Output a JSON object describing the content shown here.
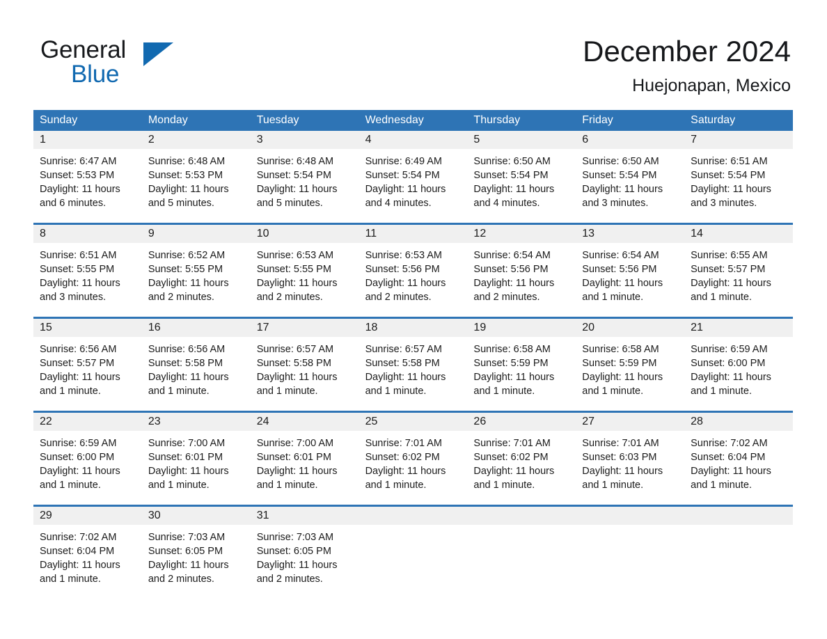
{
  "brand": {
    "name_part1": "General",
    "name_part2": "Blue",
    "triangle_color": "#1169b0"
  },
  "header": {
    "title": "December 2024",
    "subtitle": "Huejonapan, Mexico"
  },
  "colors": {
    "header_blue": "#2e74b5",
    "row_rule_blue": "#2e74b5",
    "daynum_band": "#f0f0f0",
    "text": "#1b1b1b",
    "header_text": "#ffffff"
  },
  "weekdays": [
    "Sunday",
    "Monday",
    "Tuesday",
    "Wednesday",
    "Thursday",
    "Friday",
    "Saturday"
  ],
  "weeks": [
    [
      {
        "day": "1",
        "sunrise": "Sunrise: 6:47 AM",
        "sunset": "Sunset: 5:53 PM",
        "daylight1": "Daylight: 11 hours",
        "daylight2": "and 6 minutes."
      },
      {
        "day": "2",
        "sunrise": "Sunrise: 6:48 AM",
        "sunset": "Sunset: 5:53 PM",
        "daylight1": "Daylight: 11 hours",
        "daylight2": "and 5 minutes."
      },
      {
        "day": "3",
        "sunrise": "Sunrise: 6:48 AM",
        "sunset": "Sunset: 5:54 PM",
        "daylight1": "Daylight: 11 hours",
        "daylight2": "and 5 minutes."
      },
      {
        "day": "4",
        "sunrise": "Sunrise: 6:49 AM",
        "sunset": "Sunset: 5:54 PM",
        "daylight1": "Daylight: 11 hours",
        "daylight2": "and 4 minutes."
      },
      {
        "day": "5",
        "sunrise": "Sunrise: 6:50 AM",
        "sunset": "Sunset: 5:54 PM",
        "daylight1": "Daylight: 11 hours",
        "daylight2": "and 4 minutes."
      },
      {
        "day": "6",
        "sunrise": "Sunrise: 6:50 AM",
        "sunset": "Sunset: 5:54 PM",
        "daylight1": "Daylight: 11 hours",
        "daylight2": "and 3 minutes."
      },
      {
        "day": "7",
        "sunrise": "Sunrise: 6:51 AM",
        "sunset": "Sunset: 5:54 PM",
        "daylight1": "Daylight: 11 hours",
        "daylight2": "and 3 minutes."
      }
    ],
    [
      {
        "day": "8",
        "sunrise": "Sunrise: 6:51 AM",
        "sunset": "Sunset: 5:55 PM",
        "daylight1": "Daylight: 11 hours",
        "daylight2": "and 3 minutes."
      },
      {
        "day": "9",
        "sunrise": "Sunrise: 6:52 AM",
        "sunset": "Sunset: 5:55 PM",
        "daylight1": "Daylight: 11 hours",
        "daylight2": "and 2 minutes."
      },
      {
        "day": "10",
        "sunrise": "Sunrise: 6:53 AM",
        "sunset": "Sunset: 5:55 PM",
        "daylight1": "Daylight: 11 hours",
        "daylight2": "and 2 minutes."
      },
      {
        "day": "11",
        "sunrise": "Sunrise: 6:53 AM",
        "sunset": "Sunset: 5:56 PM",
        "daylight1": "Daylight: 11 hours",
        "daylight2": "and 2 minutes."
      },
      {
        "day": "12",
        "sunrise": "Sunrise: 6:54 AM",
        "sunset": "Sunset: 5:56 PM",
        "daylight1": "Daylight: 11 hours",
        "daylight2": "and 2 minutes."
      },
      {
        "day": "13",
        "sunrise": "Sunrise: 6:54 AM",
        "sunset": "Sunset: 5:56 PM",
        "daylight1": "Daylight: 11 hours",
        "daylight2": "and 1 minute."
      },
      {
        "day": "14",
        "sunrise": "Sunrise: 6:55 AM",
        "sunset": "Sunset: 5:57 PM",
        "daylight1": "Daylight: 11 hours",
        "daylight2": "and 1 minute."
      }
    ],
    [
      {
        "day": "15",
        "sunrise": "Sunrise: 6:56 AM",
        "sunset": "Sunset: 5:57 PM",
        "daylight1": "Daylight: 11 hours",
        "daylight2": "and 1 minute."
      },
      {
        "day": "16",
        "sunrise": "Sunrise: 6:56 AM",
        "sunset": "Sunset: 5:58 PM",
        "daylight1": "Daylight: 11 hours",
        "daylight2": "and 1 minute."
      },
      {
        "day": "17",
        "sunrise": "Sunrise: 6:57 AM",
        "sunset": "Sunset: 5:58 PM",
        "daylight1": "Daylight: 11 hours",
        "daylight2": "and 1 minute."
      },
      {
        "day": "18",
        "sunrise": "Sunrise: 6:57 AM",
        "sunset": "Sunset: 5:58 PM",
        "daylight1": "Daylight: 11 hours",
        "daylight2": "and 1 minute."
      },
      {
        "day": "19",
        "sunrise": "Sunrise: 6:58 AM",
        "sunset": "Sunset: 5:59 PM",
        "daylight1": "Daylight: 11 hours",
        "daylight2": "and 1 minute."
      },
      {
        "day": "20",
        "sunrise": "Sunrise: 6:58 AM",
        "sunset": "Sunset: 5:59 PM",
        "daylight1": "Daylight: 11 hours",
        "daylight2": "and 1 minute."
      },
      {
        "day": "21",
        "sunrise": "Sunrise: 6:59 AM",
        "sunset": "Sunset: 6:00 PM",
        "daylight1": "Daylight: 11 hours",
        "daylight2": "and 1 minute."
      }
    ],
    [
      {
        "day": "22",
        "sunrise": "Sunrise: 6:59 AM",
        "sunset": "Sunset: 6:00 PM",
        "daylight1": "Daylight: 11 hours",
        "daylight2": "and 1 minute."
      },
      {
        "day": "23",
        "sunrise": "Sunrise: 7:00 AM",
        "sunset": "Sunset: 6:01 PM",
        "daylight1": "Daylight: 11 hours",
        "daylight2": "and 1 minute."
      },
      {
        "day": "24",
        "sunrise": "Sunrise: 7:00 AM",
        "sunset": "Sunset: 6:01 PM",
        "daylight1": "Daylight: 11 hours",
        "daylight2": "and 1 minute."
      },
      {
        "day": "25",
        "sunrise": "Sunrise: 7:01 AM",
        "sunset": "Sunset: 6:02 PM",
        "daylight1": "Daylight: 11 hours",
        "daylight2": "and 1 minute."
      },
      {
        "day": "26",
        "sunrise": "Sunrise: 7:01 AM",
        "sunset": "Sunset: 6:02 PM",
        "daylight1": "Daylight: 11 hours",
        "daylight2": "and 1 minute."
      },
      {
        "day": "27",
        "sunrise": "Sunrise: 7:01 AM",
        "sunset": "Sunset: 6:03 PM",
        "daylight1": "Daylight: 11 hours",
        "daylight2": "and 1 minute."
      },
      {
        "day": "28",
        "sunrise": "Sunrise: 7:02 AM",
        "sunset": "Sunset: 6:04 PM",
        "daylight1": "Daylight: 11 hours",
        "daylight2": "and 1 minute."
      }
    ],
    [
      {
        "day": "29",
        "sunrise": "Sunrise: 7:02 AM",
        "sunset": "Sunset: 6:04 PM",
        "daylight1": "Daylight: 11 hours",
        "daylight2": "and 1 minute."
      },
      {
        "day": "30",
        "sunrise": "Sunrise: 7:03 AM",
        "sunset": "Sunset: 6:05 PM",
        "daylight1": "Daylight: 11 hours",
        "daylight2": "and 2 minutes."
      },
      {
        "day": "31",
        "sunrise": "Sunrise: 7:03 AM",
        "sunset": "Sunset: 6:05 PM",
        "daylight1": "Daylight: 11 hours",
        "daylight2": "and 2 minutes."
      },
      {
        "day": "",
        "sunrise": "",
        "sunset": "",
        "daylight1": "",
        "daylight2": ""
      },
      {
        "day": "",
        "sunrise": "",
        "sunset": "",
        "daylight1": "",
        "daylight2": ""
      },
      {
        "day": "",
        "sunrise": "",
        "sunset": "",
        "daylight1": "",
        "daylight2": ""
      },
      {
        "day": "",
        "sunrise": "",
        "sunset": "",
        "daylight1": "",
        "daylight2": ""
      }
    ]
  ]
}
